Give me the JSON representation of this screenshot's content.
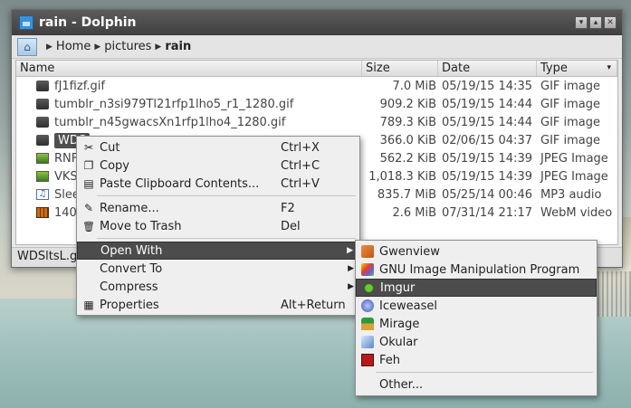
{
  "window": {
    "title": "rain - Dolphin",
    "buttons": [
      "▾",
      "▴",
      "✕"
    ]
  },
  "breadcrumb": {
    "items": [
      "Home",
      "pictures",
      "rain"
    ]
  },
  "columns": {
    "name": "Name",
    "size": "Size",
    "date": "Date",
    "type": "Type",
    "sort_indicator": "▾"
  },
  "files": [
    {
      "name": "fJ1fizf.gif",
      "size": "7.0 MiB",
      "date": "05/19/15 14:35",
      "type": "GIF image",
      "icon": "gif-file-icon"
    },
    {
      "name": "tumblr_n3si979Tl21rfp1lho5_r1_1280.gif",
      "size": "909.2 KiB",
      "date": "05/19/15 14:44",
      "type": "GIF image",
      "icon": "gif-file-icon"
    },
    {
      "name": "tumblr_n45gwacsXn1rfp1lho4_1280.gif",
      "size": "789.3 KiB",
      "date": "05/19/15 14:44",
      "type": "GIF image",
      "icon": "gif-file-icon"
    },
    {
      "name": "WDSltsL.gif",
      "size": "366.0 KiB",
      "date": "02/06/15 04:37",
      "type": "GIF image",
      "icon": "gif-file-icon",
      "selected": true
    },
    {
      "name": "RNF",
      "size": "562.2 KiB",
      "date": "05/19/15 14:39",
      "type": "JPEG Image",
      "icon": "jpeg-file-icon"
    },
    {
      "name": "VKS",
      "size": "1,018.3 KiB",
      "date": "05/19/15 14:39",
      "type": "JPEG Image",
      "icon": "jpeg-file-icon"
    },
    {
      "name": "Slee",
      "size": "835.7 MiB",
      "date": "05/25/14 00:46",
      "type": "MP3 audio",
      "icon": "mp3-file-icon"
    },
    {
      "name": "140",
      "size": "2.6 MiB",
      "date": "07/31/14 21:17",
      "type": "WebM video",
      "icon": "webm-file-icon"
    }
  ],
  "selected_visible_name": "WDS",
  "status": {
    "text": "WDSltsL.gi"
  },
  "context_menu": {
    "items": [
      {
        "label": "Cut",
        "shortcut": "Ctrl+X",
        "icon": "scissors-icon"
      },
      {
        "label": "Copy",
        "shortcut": "Ctrl+C",
        "icon": "copy-icon"
      },
      {
        "label": "Paste Clipboard Contents...",
        "shortcut": "Ctrl+V",
        "icon": "paste-icon"
      },
      {
        "label": "Rename...",
        "shortcut": "F2",
        "icon": "rename-icon"
      },
      {
        "label": "Move to Trash",
        "shortcut": "Del",
        "icon": "trash-icon"
      },
      {
        "label": "Open With",
        "submenu": true
      },
      {
        "label": "Convert To",
        "submenu": true
      },
      {
        "label": "Compress",
        "submenu": true
      },
      {
        "label": "Properties",
        "shortcut": "Alt+Return",
        "icon": "properties-icon"
      }
    ]
  },
  "open_with_menu": {
    "items": [
      {
        "label": "Gwenview",
        "icon": "gwenview-icon"
      },
      {
        "label": "GNU Image Manipulation Program",
        "icon": "gimp-icon"
      },
      {
        "label": "Imgur",
        "icon": "imgur-icon",
        "active": true
      },
      {
        "label": "Iceweasel",
        "icon": "iceweasel-icon"
      },
      {
        "label": "Mirage",
        "icon": "mirage-icon"
      },
      {
        "label": "Okular",
        "icon": "okular-icon"
      },
      {
        "label": "Feh",
        "icon": "feh-icon"
      },
      {
        "label": "Other..."
      }
    ]
  },
  "colors": {
    "menu_active_bg": "#4c4c4c",
    "selection_bg": "#505050",
    "titlebar_bg": "#4a4a4a"
  }
}
